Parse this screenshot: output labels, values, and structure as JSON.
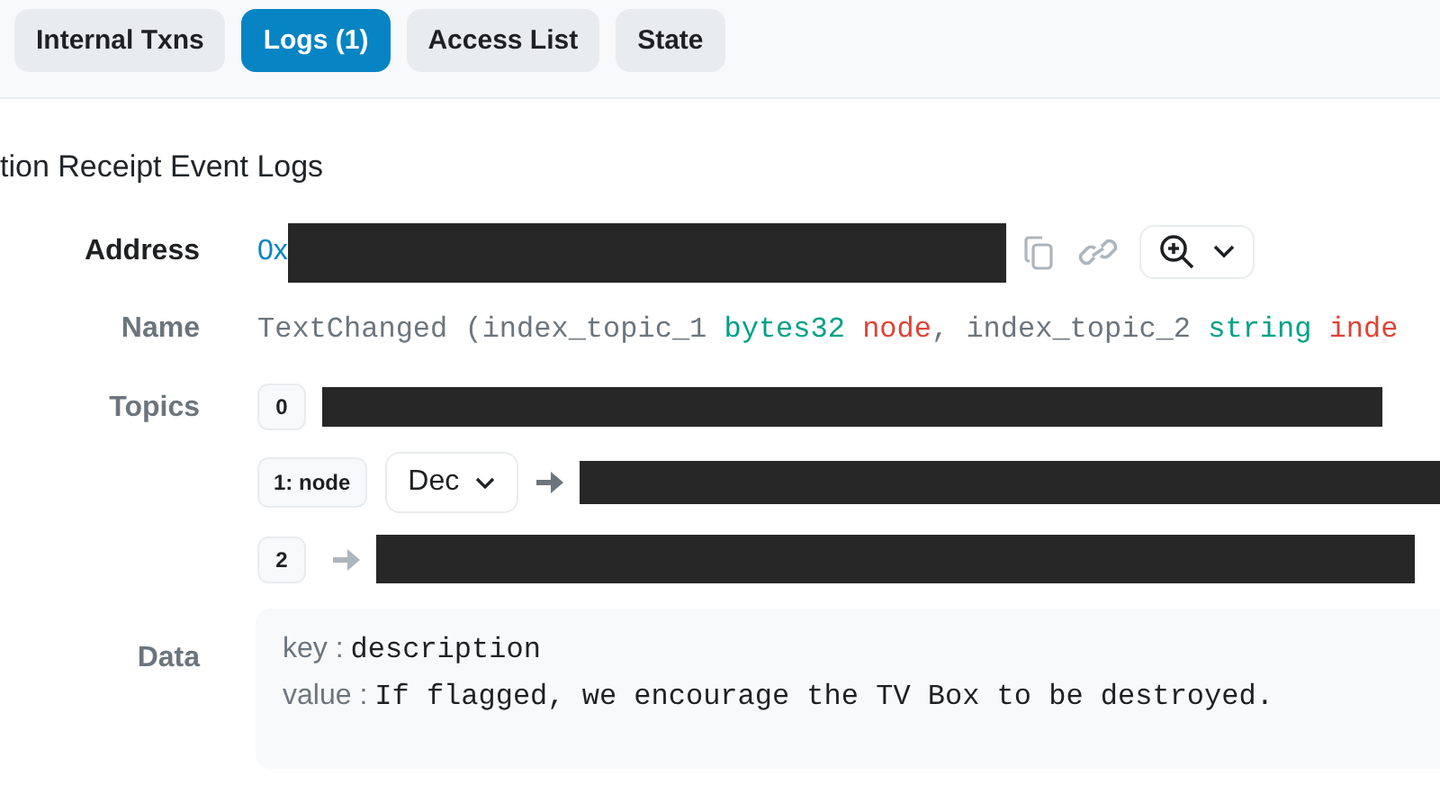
{
  "tabs": [
    {
      "label": "Internal Txns",
      "selected": false
    },
    {
      "label": "Logs (1)",
      "selected": true
    },
    {
      "label": "Access List",
      "selected": false
    },
    {
      "label": "State",
      "selected": false
    }
  ],
  "section_title": "tion Receipt Event Logs",
  "log": {
    "address": {
      "label": "Address",
      "prefix": "0x"
    },
    "name": {
      "label": "Name",
      "tokens": [
        {
          "text": "TextChanged (index_topic_1 ",
          "kind": "plain"
        },
        {
          "text": "bytes32",
          "kind": "type"
        },
        {
          "text": " node",
          "kind": "param"
        },
        {
          "text": ", index_topic_2 ",
          "kind": "plain"
        },
        {
          "text": "string",
          "kind": "type"
        },
        {
          "text": " inde",
          "kind": "param"
        }
      ]
    },
    "topics": {
      "label": "Topics",
      "items": [
        {
          "index": "0",
          "kind": "plain"
        },
        {
          "index": "1: node",
          "kind": "decoded",
          "decoder": "Dec"
        },
        {
          "index": "2",
          "kind": "arrow"
        }
      ]
    },
    "data": {
      "label": "Data",
      "entries": [
        {
          "key": "key :",
          "value": "description"
        },
        {
          "key": "value :",
          "value": "If flagged, we encourage the TV Box to be destroyed."
        }
      ]
    }
  }
}
